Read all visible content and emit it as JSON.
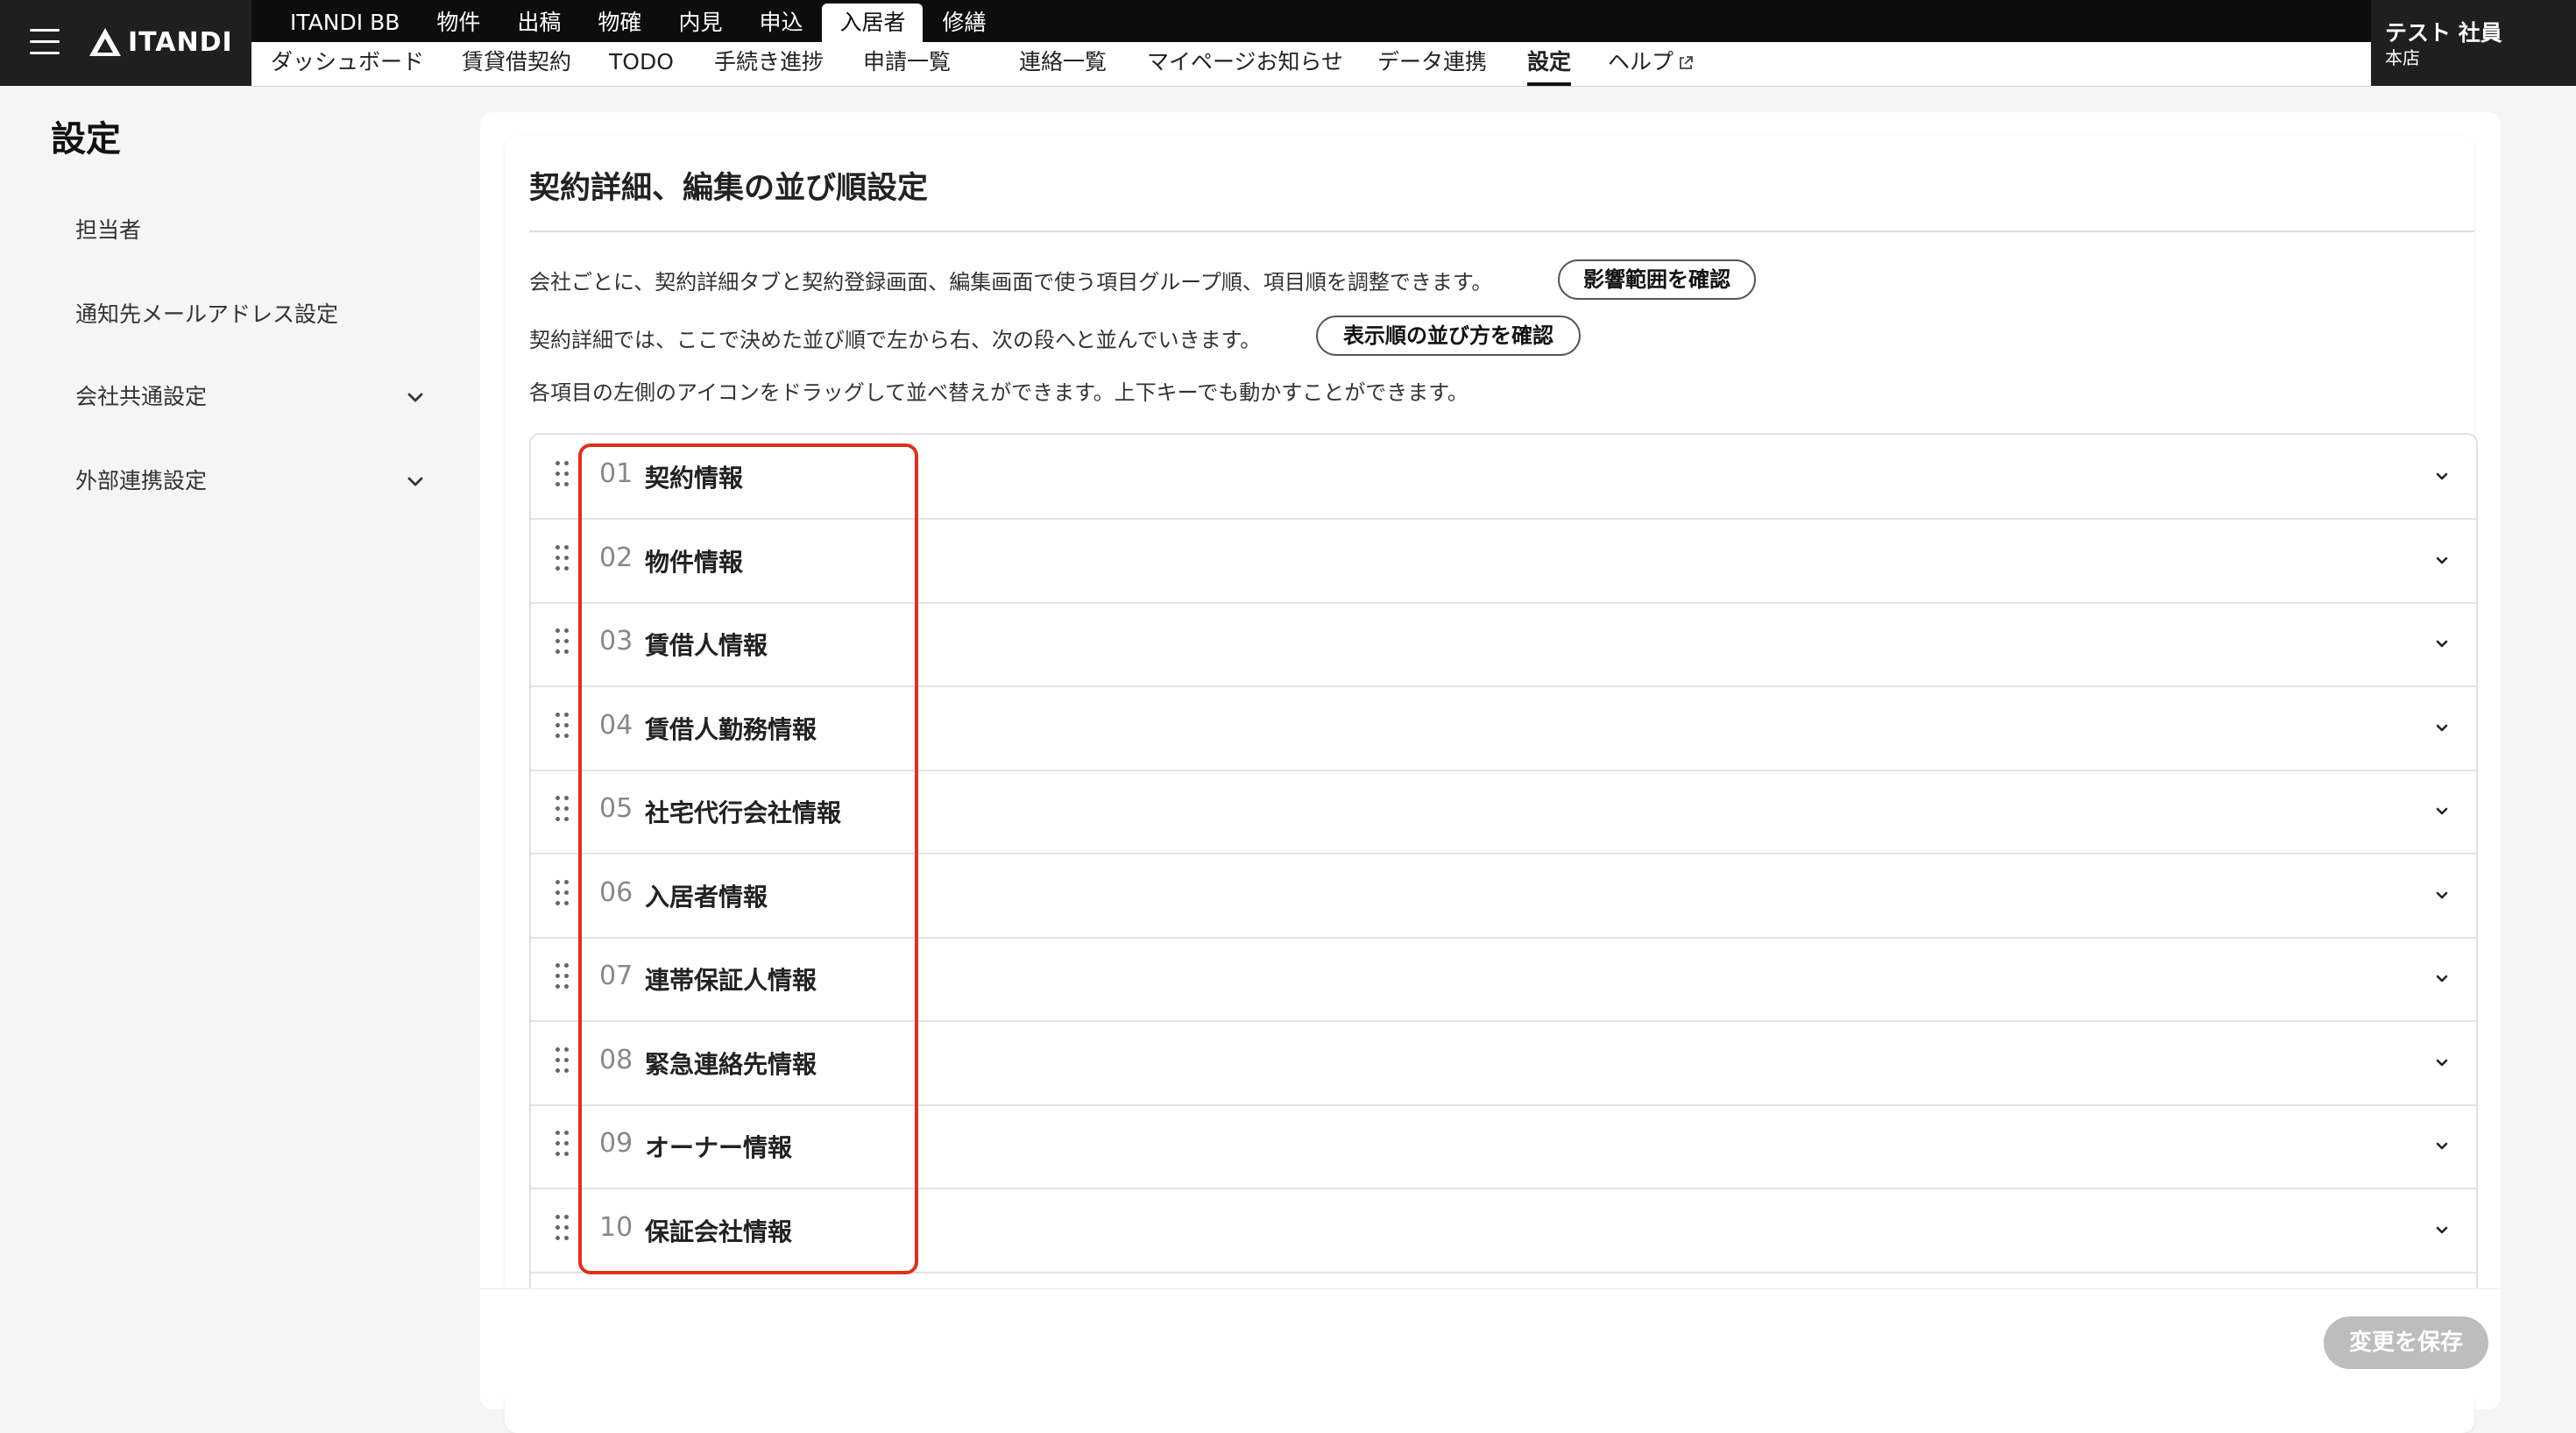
{
  "brand": {
    "logo_text": "ITANDI"
  },
  "nav_top": [
    "ITANDI BB",
    "物件",
    "出稿",
    "物確",
    "内見",
    "申込",
    "入居者",
    "修繕"
  ],
  "nav_top_active": "入居者",
  "nav_sub": [
    "ダッシュボード",
    "賃貸借契約",
    "TODO",
    "手続き進捗",
    "申請一覧",
    "連絡一覧",
    "マイページお知らせ",
    "データ連携",
    "設定",
    "ヘルプ"
  ],
  "nav_sub_active": "設定",
  "user": {
    "name": "テスト 社員",
    "store": "本店"
  },
  "sidebar": {
    "title": "設定",
    "items": [
      {
        "label": "担当者",
        "expandable": false
      },
      {
        "label": "通知先メールアドレス設定",
        "expandable": false
      },
      {
        "label": "会社共通設定",
        "expandable": true
      },
      {
        "label": "外部連携設定",
        "expandable": true
      }
    ]
  },
  "main": {
    "title": "契約詳細、編集の並び順設定",
    "desc1": "会社ごとに、契約詳細タブと契約登録画面、編集画面で使う項目グループ順、項目順を調整できます。",
    "btn_scope": "影響範囲を確認",
    "desc2": "契約詳細では、ここで決めた並び順で左から右、次の段へと並んでいきます。",
    "btn_order": "表示順の並び方を確認",
    "desc3": "各項目の左側のアイコンをドラッグして並べ替えができます。上下キーでも動かすことができます。",
    "groups": [
      {
        "num": "01",
        "label": "契約情報"
      },
      {
        "num": "02",
        "label": "物件情報"
      },
      {
        "num": "03",
        "label": "賃借人情報"
      },
      {
        "num": "04",
        "label": "賃借人勤務情報"
      },
      {
        "num": "05",
        "label": "社宅代行会社情報"
      },
      {
        "num": "06",
        "label": "入居者情報"
      },
      {
        "num": "07",
        "label": "連帯保証人情報"
      },
      {
        "num": "08",
        "label": "緊急連絡先情報"
      },
      {
        "num": "09",
        "label": "オーナー情報"
      },
      {
        "num": "10",
        "label": "保証会社情報"
      }
    ],
    "save_label": "変更を保存"
  },
  "colors": {
    "highlight": "#e0301e",
    "save_disabled": "#bdbdbd",
    "header_dark": "#0d0d0d"
  }
}
